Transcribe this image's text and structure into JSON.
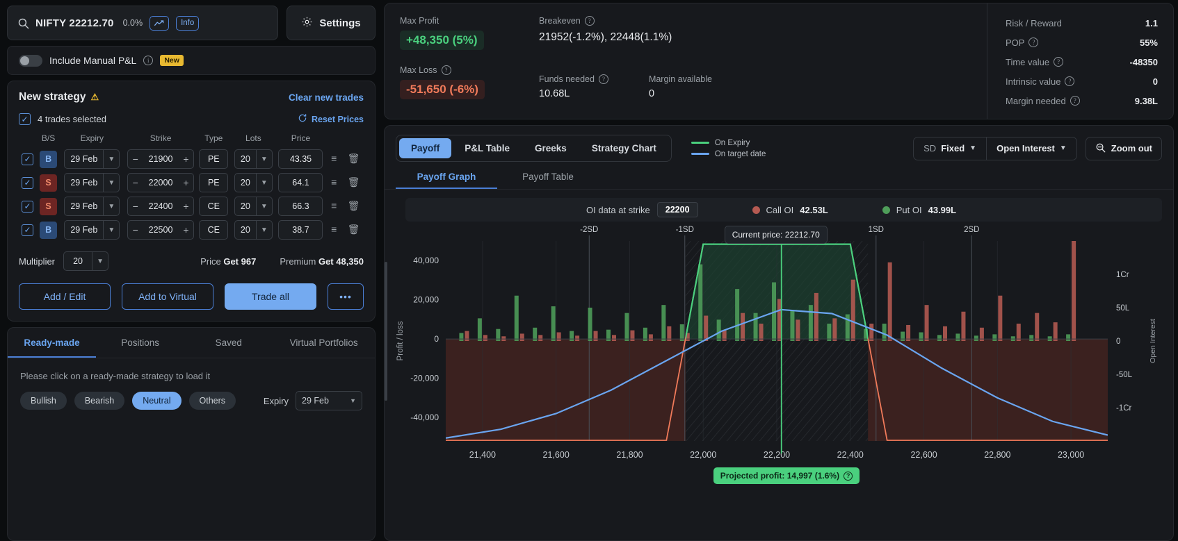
{
  "search": {
    "symbol": "NIFTY 22212.70",
    "change_pct": "0.0%",
    "chart_icon": "trend-up-icon",
    "info_label": "Info"
  },
  "settings": {
    "label": "Settings",
    "icon": "gear-icon"
  },
  "manual_pnl": {
    "label": "Include Manual P&L",
    "badge": "New",
    "toggle_state": "off"
  },
  "strategy": {
    "title": "New strategy",
    "clear_label": "Clear new trades",
    "selected_label": "4 trades selected",
    "reset_label": "Reset Prices",
    "columns": [
      "B/S",
      "Expiry",
      "Strike",
      "Type",
      "Lots",
      "Price"
    ],
    "rows": [
      {
        "bs": "B",
        "side": "buy",
        "expiry": "29 Feb",
        "strike": "21900",
        "type": "PE",
        "lots": "20",
        "price": "43.35"
      },
      {
        "bs": "S",
        "side": "sell",
        "expiry": "29 Feb",
        "strike": "22000",
        "type": "PE",
        "lots": "20",
        "price": "64.1"
      },
      {
        "bs": "S",
        "side": "sell",
        "expiry": "29 Feb",
        "strike": "22400",
        "type": "CE",
        "lots": "20",
        "price": "66.3"
      },
      {
        "bs": "B",
        "side": "buy",
        "expiry": "29 Feb",
        "strike": "22500",
        "type": "CE",
        "lots": "20",
        "price": "38.7"
      }
    ],
    "multiplier_label": "Multiplier",
    "multiplier_value": "20",
    "price_label": "Price",
    "price_value": "Get 967",
    "premium_label": "Premium",
    "premium_value": "Get 48,350",
    "buttons": {
      "add_edit": "Add / Edit",
      "add_virtual": "Add to Virtual",
      "trade_all": "Trade all",
      "more": "•••"
    }
  },
  "bottom": {
    "tabs": [
      "Ready-made",
      "Positions",
      "Saved",
      "Virtual Portfolios"
    ],
    "active_tab": "Ready-made",
    "hint": "Please click on a ready-made strategy to load it",
    "chips": [
      "Bullish",
      "Bearish",
      "Neutral",
      "Others"
    ],
    "active_chip": "Neutral",
    "expiry_label": "Expiry",
    "expiry_value": "29 Feb"
  },
  "stats": {
    "max_profit_label": "Max Profit",
    "max_profit_value": "+48,350 (5%)",
    "max_loss_label": "Max Loss",
    "max_loss_value": "-51,650 (-6%)",
    "breakeven_label": "Breakeven",
    "breakeven_value": "21952(-1.2%),  22448(1.1%)",
    "funds_label": "Funds needed",
    "funds_value": "10.68L",
    "margin_label": "Margin available",
    "margin_value": "0",
    "metrics": [
      {
        "key": "Risk / Reward",
        "value": "1.1",
        "help": false
      },
      {
        "key": "POP",
        "value": "55%",
        "help": true
      },
      {
        "key": "Time value",
        "value": "-48350",
        "help": true
      },
      {
        "key": "Intrinsic value",
        "value": "0",
        "help": true
      },
      {
        "key": "Margin needed",
        "value": "9.38L",
        "help": true
      }
    ]
  },
  "chart_toolbar": {
    "segments": [
      "Payoff",
      "P&L Table",
      "Greeks",
      "Strategy Chart"
    ],
    "active_segment": "Payoff",
    "legend": [
      {
        "label": "On Expiry",
        "color": "#4ad07e"
      },
      {
        "label": "On target date",
        "color": "#6aa5f0"
      }
    ],
    "sd_prefix": "SD",
    "sd_value": "Fixed",
    "oi_value": "Open Interest",
    "zoom_out": "Zoom out",
    "subtabs": [
      "Payoff Graph",
      "Payoff Table"
    ],
    "active_subtab": "Payoff Graph"
  },
  "oi_strip": {
    "label": "OI data at strike",
    "strike": "22200",
    "call_label": "Call OI",
    "call_value": "42.53L",
    "call_color": "#b55a52",
    "put_label": "Put OI",
    "put_value": "43.99L",
    "put_color": "#4f9e5a"
  },
  "annotations": {
    "current_price": "Current price: 22212.70",
    "projected": "Projected profit: 14,997 (1.6%)"
  },
  "chart_data": {
    "type": "line",
    "title": "Payoff Graph",
    "xlabel": "",
    "ylabel": "Profit / loss",
    "y2label": "Open Interest",
    "xlim": [
      21300,
      23100
    ],
    "ylim": [
      -52000,
      50000
    ],
    "y2lim": [
      -15000000,
      15000000
    ],
    "xticks": [
      21400,
      21600,
      21800,
      22000,
      22200,
      22400,
      22600,
      22800,
      23000
    ],
    "xticklabels": [
      "21,400",
      "21,600",
      "21,800",
      "22,000",
      "22,200",
      "22,400",
      "22,600",
      "22,800",
      "23,000"
    ],
    "yticks": [
      -40000,
      -20000,
      0,
      20000,
      40000
    ],
    "yticklabels": [
      "-40,000",
      "-20,000",
      "0",
      "20,000",
      "40,000"
    ],
    "y2ticks": [
      -10000000,
      -5000000,
      0,
      5000000,
      10000000
    ],
    "y2ticklabels": [
      "-1Cr",
      "-50L",
      "0",
      "50L",
      "1Cr"
    ],
    "sd_markers": [
      {
        "label": "-2SD",
        "x": 21690
      },
      {
        "label": "-1SD",
        "x": 21950
      },
      {
        "label": "1SD",
        "x": 22470
      },
      {
        "label": "2SD",
        "x": 22730
      }
    ],
    "current_price_x": 22212.7,
    "breakevens": [
      21952,
      22448
    ],
    "series": [
      {
        "name": "On Expiry",
        "color_profit": "#4ad07e",
        "color_loss": "#f07a5a",
        "points": [
          [
            21300,
            -51650
          ],
          [
            21900,
            -51650
          ],
          [
            22000,
            48350
          ],
          [
            22400,
            48350
          ],
          [
            22500,
            -51650
          ],
          [
            23100,
            -51650
          ]
        ]
      },
      {
        "name": "On target date",
        "color": "#6aa5f0",
        "points": [
          [
            21300,
            -50500
          ],
          [
            21450,
            -46000
          ],
          [
            21600,
            -38000
          ],
          [
            21750,
            -26000
          ],
          [
            21900,
            -11000
          ],
          [
            22050,
            4000
          ],
          [
            22212,
            14997
          ],
          [
            22350,
            13000
          ],
          [
            22500,
            2000
          ],
          [
            22650,
            -15000
          ],
          [
            22800,
            -30000
          ],
          [
            22950,
            -42000
          ],
          [
            23100,
            -49000
          ]
        ]
      }
    ],
    "open_interest_bars": [
      {
        "x": 21350,
        "call": 1500000,
        "put": 1200000
      },
      {
        "x": 21400,
        "call": 900000,
        "put": 3400000
      },
      {
        "x": 21450,
        "call": 700000,
        "put": 1800000
      },
      {
        "x": 21500,
        "call": 1100000,
        "put": 6800000
      },
      {
        "x": 21550,
        "call": 900000,
        "put": 2000000
      },
      {
        "x": 21600,
        "call": 1300000,
        "put": 5200000
      },
      {
        "x": 21650,
        "call": 800000,
        "put": 1500000
      },
      {
        "x": 21700,
        "call": 1500000,
        "put": 5000000
      },
      {
        "x": 21750,
        "call": 900000,
        "put": 1700000
      },
      {
        "x": 21800,
        "call": 1600000,
        "put": 4200000
      },
      {
        "x": 21850,
        "call": 1000000,
        "put": 2000000
      },
      {
        "x": 21900,
        "call": 2200000,
        "put": 5400000
      },
      {
        "x": 21950,
        "call": 1200000,
        "put": 2500000
      },
      {
        "x": 22000,
        "call": 3800000,
        "put": 11500000
      },
      {
        "x": 22050,
        "call": 1600000,
        "put": 3200000
      },
      {
        "x": 22100,
        "call": 4200000,
        "put": 7800000
      },
      {
        "x": 22150,
        "call": 2600000,
        "put": 4200000
      },
      {
        "x": 22200,
        "call": 6300000,
        "put": 8800000
      },
      {
        "x": 22250,
        "call": 3200000,
        "put": 4600000
      },
      {
        "x": 22300,
        "call": 7200000,
        "put": 5400000
      },
      {
        "x": 22350,
        "call": 3400000,
        "put": 2600000
      },
      {
        "x": 22400,
        "call": 9200000,
        "put": 4000000
      },
      {
        "x": 22450,
        "call": 2600000,
        "put": 1800000
      },
      {
        "x": 22500,
        "call": 11800000,
        "put": 2600000
      },
      {
        "x": 22550,
        "call": 2400000,
        "put": 1400000
      },
      {
        "x": 22600,
        "call": 5400000,
        "put": 1300000
      },
      {
        "x": 22650,
        "call": 2200000,
        "put": 900000
      },
      {
        "x": 22700,
        "call": 4400000,
        "put": 1100000
      },
      {
        "x": 22750,
        "call": 2000000,
        "put": 800000
      },
      {
        "x": 22800,
        "call": 6800000,
        "put": 1000000
      },
      {
        "x": 22850,
        "call": 2600000,
        "put": 700000
      },
      {
        "x": 22900,
        "call": 4200000,
        "put": 900000
      },
      {
        "x": 22950,
        "call": 2800000,
        "put": 700000
      },
      {
        "x": 23000,
        "call": 15500000,
        "put": 1000000
      }
    ]
  }
}
